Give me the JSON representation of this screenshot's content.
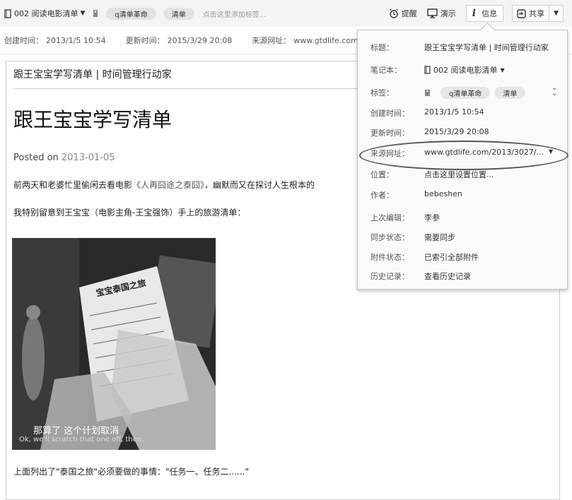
{
  "toolbar": {
    "notebook": "002 阅读电影清单",
    "tags": [
      "q清单革命",
      "清单"
    ],
    "tag_hint": "点击这里添加标签...",
    "remind_label": "提醒",
    "present_label": "演示",
    "info_label": "信息",
    "share_label": "共享"
  },
  "meta_bar": {
    "created_label": "创建时间：",
    "created_value": "2013/1/5 10:54",
    "updated_label": "更新时间：",
    "updated_value": "2015/3/29 20:08",
    "source_label": "来源网址：",
    "source_value": "www.gtdlife.com"
  },
  "article": {
    "header": "跟王宝宝学写清单 | 时间管理行动家",
    "title": "跟王宝宝学写清单",
    "posted_label": "Posted on",
    "posted_date": "2013-01-05",
    "para1_text": "前两天和老婆忙里偷闲去看电影",
    "para1_link": "《人再囧途之泰囧》",
    "para1_text2": "，幽默而又在探讨人生根本的",
    "para2": "我特别留意到王宝宝（电影主角-王宝强饰）手上的旅游清单：",
    "photo_subtitle_cn": "那算了  这个计划取消",
    "photo_subtitle_en": "Ok, we'll scratch that one off, then.",
    "photo_paper_heading": "宝宝泰国之旅",
    "para3": "上面列出了\"泰国之旅\"必须要做的事情：\"任务一、任务二......\""
  },
  "info_popup": {
    "rows": [
      {
        "label": "标题：",
        "value": "跟王宝宝学写清单 | 时间管理行动家"
      },
      {
        "label": "笔记本：",
        "value": "002 阅读电影清单"
      },
      {
        "label": "标签：",
        "value": ""
      },
      {
        "label": "创建时间：",
        "value": "2013/1/5 10:54"
      },
      {
        "label": "更新时间：",
        "value": "2015/3/29 20:08"
      },
      {
        "label": "来源网址：",
        "value": "www.gtdlife.com/2013/3027/..."
      },
      {
        "label": "位置：",
        "value": "点击这里设置位置..."
      },
      {
        "label": "作者：",
        "value": "bebeshen"
      },
      {
        "label": "上次编辑：",
        "value": "李参"
      },
      {
        "label": "同步状态：",
        "value": "需要同步"
      },
      {
        "label": "附件状态：",
        "value": "已索引全部附件"
      },
      {
        "label": "历史记录：",
        "value": "查看历史记录"
      }
    ],
    "tags": [
      "q清单革命",
      "清单"
    ]
  }
}
